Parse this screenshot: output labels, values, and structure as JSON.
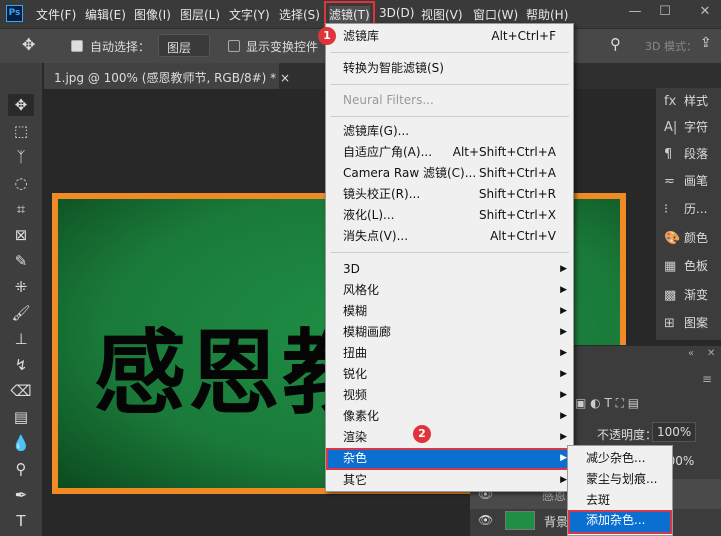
{
  "app": {
    "logo": "Ps"
  },
  "menubar": [
    "文件(F)",
    "编辑(E)",
    "图像(I)",
    "图层(L)",
    "文字(Y)",
    "选择(S)",
    "滤镜(T)",
    "3D(D)",
    "视图(V)",
    "窗口(W)",
    "帮助(H)"
  ],
  "window_controls": [
    "—",
    "☐",
    "✕"
  ],
  "options": {
    "auto_select": "自动选择：",
    "layer_select": "图层",
    "show_transform": "显示变换控件",
    "mode3d": "3D 模式："
  },
  "document_tab": {
    "title": "1.jpg @ 100% (感恩教师节, RGB/8#) *",
    "close": "×"
  },
  "canvas": {
    "text": "感恩教师节"
  },
  "filter_menu": {
    "top": [
      {
        "label": "滤镜库",
        "shortcut": "Alt+Ctrl+F"
      }
    ],
    "smart": "转换为智能滤镜(S)",
    "neural": "Neural Filters...",
    "group1": [
      {
        "label": "滤镜库(G)...",
        "shortcut": ""
      },
      {
        "label": "自适应广角(A)...",
        "shortcut": "Alt+Shift+Ctrl+A"
      },
      {
        "label": "Camera Raw 滤镜(C)...",
        "shortcut": "Shift+Ctrl+A"
      },
      {
        "label": "镜头校正(R)...",
        "shortcut": "Shift+Ctrl+R"
      },
      {
        "label": "液化(L)...",
        "shortcut": "Shift+Ctrl+X"
      },
      {
        "label": "消失点(V)...",
        "shortcut": "Alt+Ctrl+V"
      }
    ],
    "group2": [
      "3D",
      "风格化",
      "模糊",
      "模糊画廊",
      "扭曲",
      "锐化",
      "视频",
      "像素化",
      "渲染",
      "杂色",
      "其它"
    ]
  },
  "noise_submenu": [
    "减少杂色...",
    "蒙尘与划痕...",
    "去斑",
    "添加杂色..."
  ],
  "badges": [
    "1",
    "2"
  ],
  "right_panels": [
    "样式",
    "字符",
    "段落",
    "画笔",
    "历...",
    "颜色",
    "色板",
    "渐变",
    "图案"
  ],
  "layers": {
    "opacity_label": "不透明度：",
    "opacity": "100%",
    "fill": "100%",
    "layer_text": "感恩",
    "background": "背景"
  },
  "colors": {
    "accent": "#0a6fd1",
    "highlight": "#e0333b",
    "frame": "#f08a24"
  }
}
